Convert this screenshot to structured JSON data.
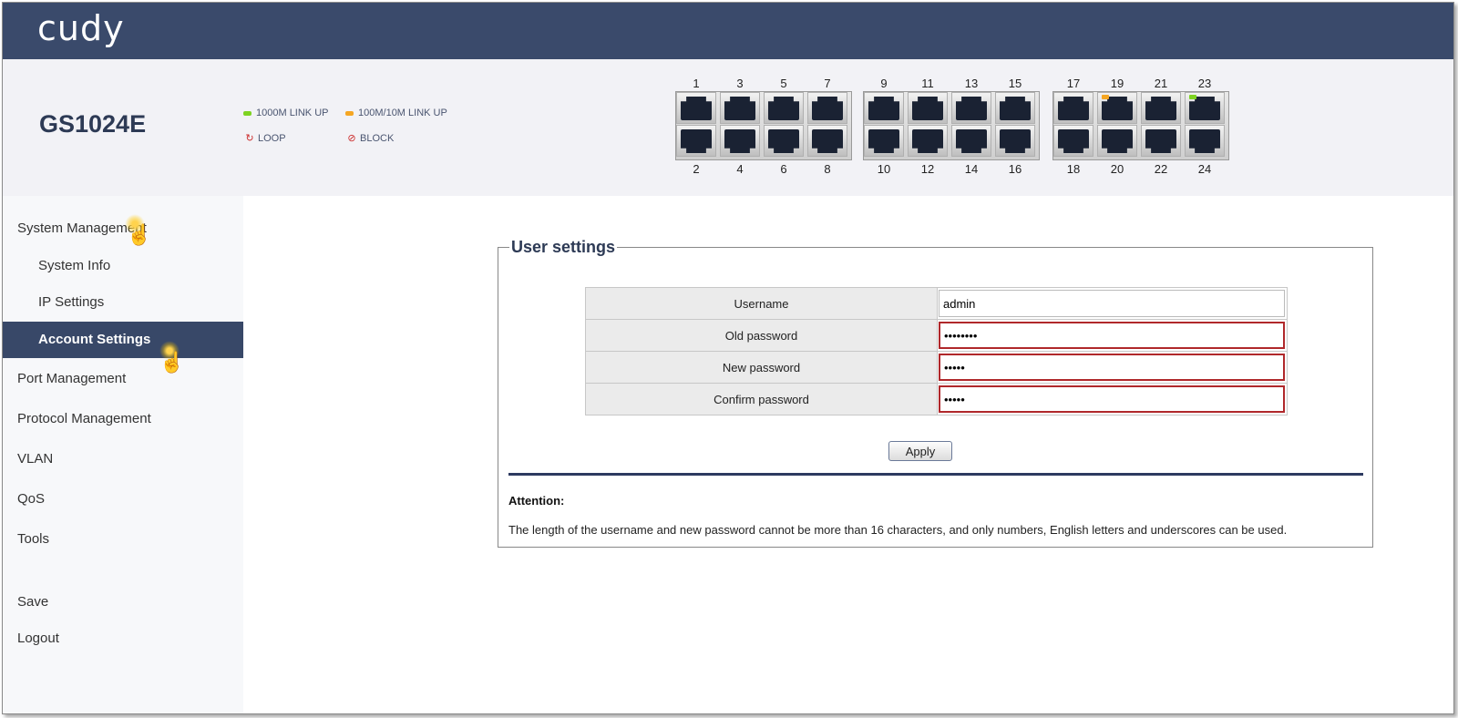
{
  "header": {
    "logo": "cudy"
  },
  "device": {
    "model": "GS1024E",
    "legend": {
      "link_1000": "1000M LINK UP",
      "link_100": "100M/10M LINK UP",
      "loop": "LOOP",
      "block": "BLOCK",
      "colors": {
        "link_1000": "#7ed321",
        "link_100": "#f5a623",
        "loop": "#d0021b",
        "block": "#d0021b"
      }
    },
    "ports_top": [
      "1",
      "3",
      "5",
      "7",
      "9",
      "11",
      "13",
      "15",
      "17",
      "19",
      "21",
      "23"
    ],
    "ports_bottom": [
      "2",
      "4",
      "6",
      "8",
      "10",
      "12",
      "14",
      "16",
      "18",
      "20",
      "22",
      "24"
    ],
    "port_leds": {
      "19": "#f5a623",
      "23": "#7ed321"
    }
  },
  "sidebar": {
    "items": [
      {
        "label": "System Management"
      },
      {
        "label": "System Info"
      },
      {
        "label": "IP Settings"
      },
      {
        "label": "Account Settings"
      },
      {
        "label": "Port Management"
      },
      {
        "label": "Protocol Management"
      },
      {
        "label": "VLAN"
      },
      {
        "label": "QoS"
      },
      {
        "label": "Tools"
      },
      {
        "label": "Save"
      },
      {
        "label": "Logout"
      }
    ],
    "active": "Account Settings"
  },
  "form": {
    "title": "User settings",
    "username_label": "Username",
    "username_value": "admin",
    "old_password_label": "Old password",
    "old_password_value": "••••••••",
    "new_password_label": "New password",
    "new_password_value": "•••••",
    "confirm_password_label": "Confirm password",
    "confirm_password_value": "•••••",
    "apply_label": "Apply"
  },
  "attention": {
    "title": "Attention:",
    "text": "The length of the username and new password cannot be more than 16 characters, and only numbers, English letters and underscores can be used."
  },
  "colors": {
    "header_bg": "#3a4a6b",
    "active_nav": "#384868",
    "error_border": "#b0282b"
  }
}
